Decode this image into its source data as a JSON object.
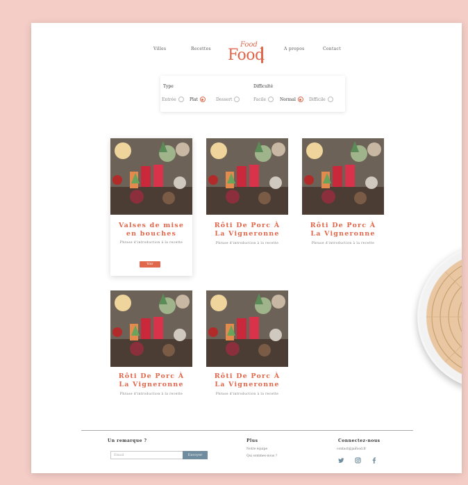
{
  "nav": {
    "items": [
      "Villes",
      "Recettes",
      "A propos",
      "Contact"
    ],
    "logo_script": "Food",
    "logo_word": "Food"
  },
  "filter": {
    "type_label": "Type",
    "type_options": [
      {
        "label": "Entrée",
        "checked": false
      },
      {
        "label": "Plat",
        "checked": true
      },
      {
        "label": "Dessert",
        "checked": false
      }
    ],
    "difficulty_label": "Difficulté",
    "difficulty_options": [
      {
        "label": "Facile",
        "checked": false
      },
      {
        "label": "Normal",
        "checked": true
      },
      {
        "label": "Difficile",
        "checked": false
      }
    ]
  },
  "cards": [
    {
      "title": "Valses de mise en bouches",
      "desc": "Phrase d'introduction à la recette",
      "button": "Voir"
    },
    {
      "title": "Rôti De Porc À La Vigneronne",
      "desc": "Phrase d'introduction à la recette"
    },
    {
      "title": "Rôti De Porc À La Vigneronne",
      "desc": "Phrase d'introduction à la recette"
    },
    {
      "title": "Rôti De Porc À La Vigneronne",
      "desc": "Phrase d'introduction à la recette"
    },
    {
      "title": "Rôti De Porc À La Vigneronne",
      "desc": "Phrase d'introduction à la recette"
    }
  ],
  "footer": {
    "remark_title": "Un remarque ?",
    "email_placeholder": "Email",
    "submit_label": "Envoyer",
    "more_title": "Plus",
    "more_links": [
      "Notre équipe",
      "Qui sommes-nous ?"
    ],
    "connect_title": "Connectez-nous",
    "connect_email": "contact@jaifood.fr",
    "social_icons": [
      "twitter-icon",
      "instagram-icon",
      "facebook-icon"
    ]
  },
  "colors": {
    "accent": "#e0674b",
    "background": "#f4cdc6",
    "submit": "#6f8d9e"
  }
}
